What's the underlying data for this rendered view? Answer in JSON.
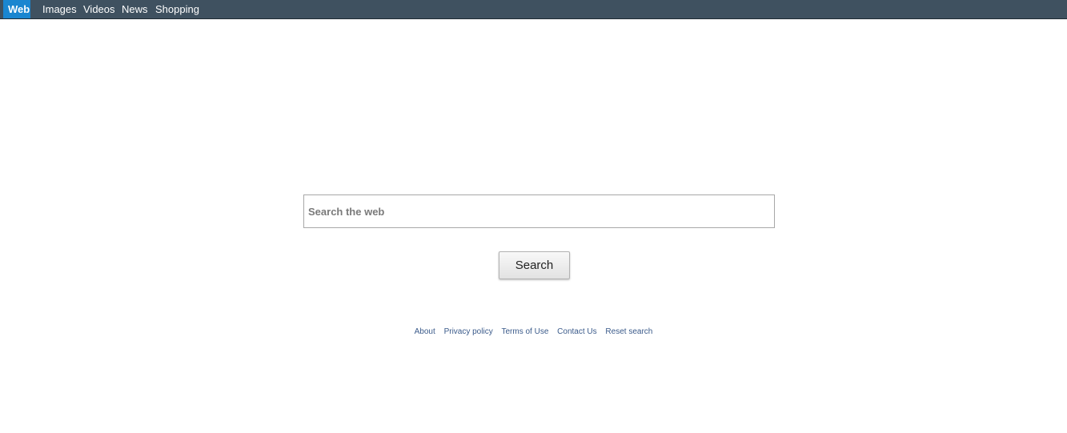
{
  "nav": {
    "items": [
      {
        "label": "Web",
        "active": true
      },
      {
        "label": "Images",
        "active": false
      },
      {
        "label": "Videos",
        "active": false
      },
      {
        "label": "News",
        "active": false
      },
      {
        "label": "Shopping",
        "active": false
      }
    ]
  },
  "search": {
    "placeholder": "Search the web",
    "value": "",
    "button_label": "Search"
  },
  "footer": {
    "links": [
      "About",
      "Privacy policy",
      "Terms of Use",
      "Contact Us",
      "Reset search"
    ]
  },
  "colors": {
    "topbar": "#3f5160",
    "active_tab": "#1a86d0",
    "footer_link": "#3a5a8a"
  }
}
